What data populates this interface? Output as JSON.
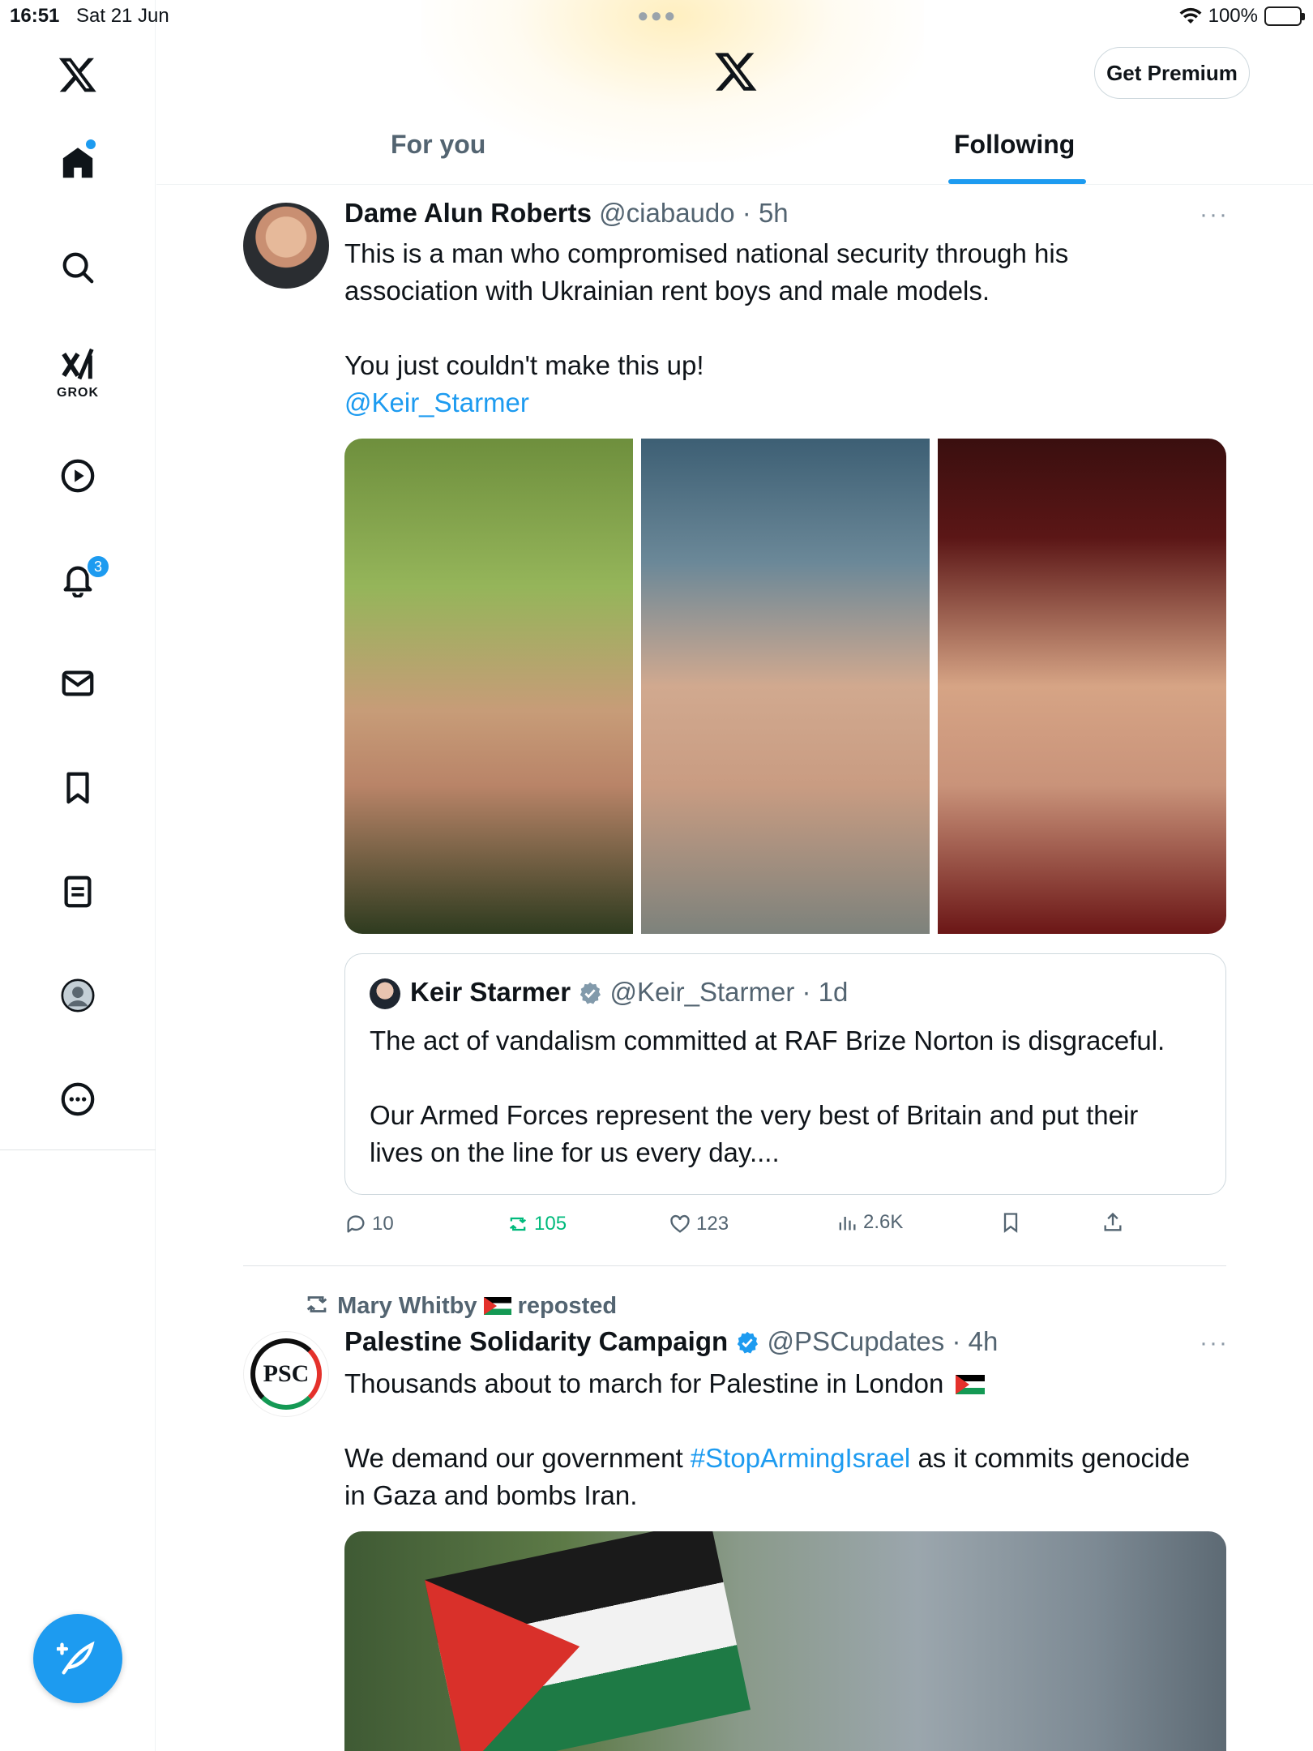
{
  "status_bar": {
    "time": "16:51",
    "date": "Sat 21 Jun",
    "battery": "100%"
  },
  "header": {
    "premium_label": "Get Premium",
    "tabs": [
      {
        "label": "For you",
        "active": false
      },
      {
        "label": "Following",
        "active": true
      }
    ]
  },
  "sidebar": {
    "grok_label": "GROK",
    "notifications_badge": "3"
  },
  "tweet1": {
    "author_name": "Dame Alun Roberts",
    "handle": "@ciabaudo",
    "time": "5h",
    "text_line1": "This is a man who compromised national security through his",
    "text_line2": "association with Ukrainian rent boys and male models.",
    "text_line3": "You just couldn't make this up!",
    "mention": "@Keir_Starmer",
    "quote": {
      "author_name": "Keir Starmer",
      "handle": "@Keir_Starmer",
      "time": "1d",
      "text_line1": "The act of vandalism committed at RAF Brize Norton is disgraceful.",
      "text_line2": "Our Armed Forces represent the very best of Britain and put their",
      "text_line3": "lives on the line for us every day...."
    },
    "stats": {
      "replies": "10",
      "reposts": "105",
      "likes": "123",
      "views": "2.6K"
    }
  },
  "tweet2": {
    "reposted_by": "Mary Whitby",
    "reposted_label": "reposted",
    "author_name": "Palestine Solidarity Campaign",
    "handle": "@PSCupdates",
    "time": "4h",
    "text_line1": "Thousands about to march for Palestine in London",
    "text_line2_pre": "We demand our government",
    "hashtag": "#StopArmingIsrael",
    "text_line2_post": "as it commits genocide",
    "text_line3": "in Gaza and bombs Iran.",
    "avatar_text": "PSC"
  },
  "colors": {
    "accent": "#1d9bf0",
    "repost_green": "#00ba7c",
    "text": "#0f1419",
    "muted": "#536471"
  }
}
